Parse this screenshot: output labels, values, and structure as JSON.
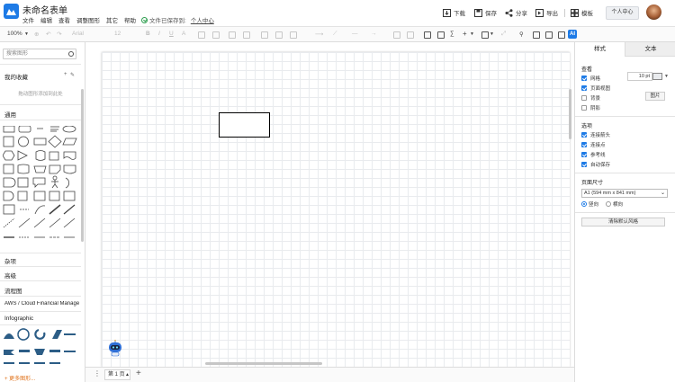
{
  "app": {
    "title": "未命名表单"
  },
  "menu": [
    "文件",
    "编辑",
    "查看",
    "调整图形",
    "其它",
    "帮助"
  ],
  "save_status": {
    "text": "文件已保存到:",
    "location": "个人中心"
  },
  "header_actions": {
    "download": "下载",
    "save": "保存",
    "share": "分享",
    "export": "导出",
    "template": "模板",
    "user_center": "个人中心"
  },
  "toolbar": {
    "zoom": "100%",
    "font": "Arial",
    "font_size": "12",
    "ai": "AI"
  },
  "left_panel": {
    "search_placeholder": "搜索图形",
    "favorites": "我的收藏",
    "favorites_hint": "拖动图形添加到此处",
    "general": "通用",
    "categories": [
      "杂项",
      "高级",
      "流程图",
      "AWS / Cloud Financial Manage",
      "Infographic"
    ],
    "more_shapes": "+ 更多图形..."
  },
  "page_tabs": {
    "current": "第 1 页",
    "add": "+"
  },
  "right_panel": {
    "tabs": [
      "样式",
      "文本"
    ],
    "view_section": "查看",
    "view_options": [
      {
        "label": "网格",
        "checked": true
      },
      {
        "label": "页面视图",
        "checked": true
      },
      {
        "label": "背景",
        "checked": false
      },
      {
        "label": "阴影",
        "checked": false
      }
    ],
    "grid_size": "10 pt",
    "image_button": "图片",
    "options_section": "选项",
    "options": [
      {
        "label": "连接箭头",
        "checked": true
      },
      {
        "label": "连接点",
        "checked": true
      },
      {
        "label": "参考线",
        "checked": true
      },
      {
        "label": "自动保存",
        "checked": true
      }
    ],
    "page_size_section": "页面尺寸",
    "page_size": "A1 (594 mm x 841 mm)",
    "orientation": [
      {
        "label": "竖向",
        "selected": true
      },
      {
        "label": "横向",
        "selected": false
      }
    ],
    "clear_default_style": "清除默认风格"
  },
  "colors": {
    "accent": "#1e7be6",
    "more_shapes": "#e07017",
    "shape_fill": "#2c5d86"
  }
}
